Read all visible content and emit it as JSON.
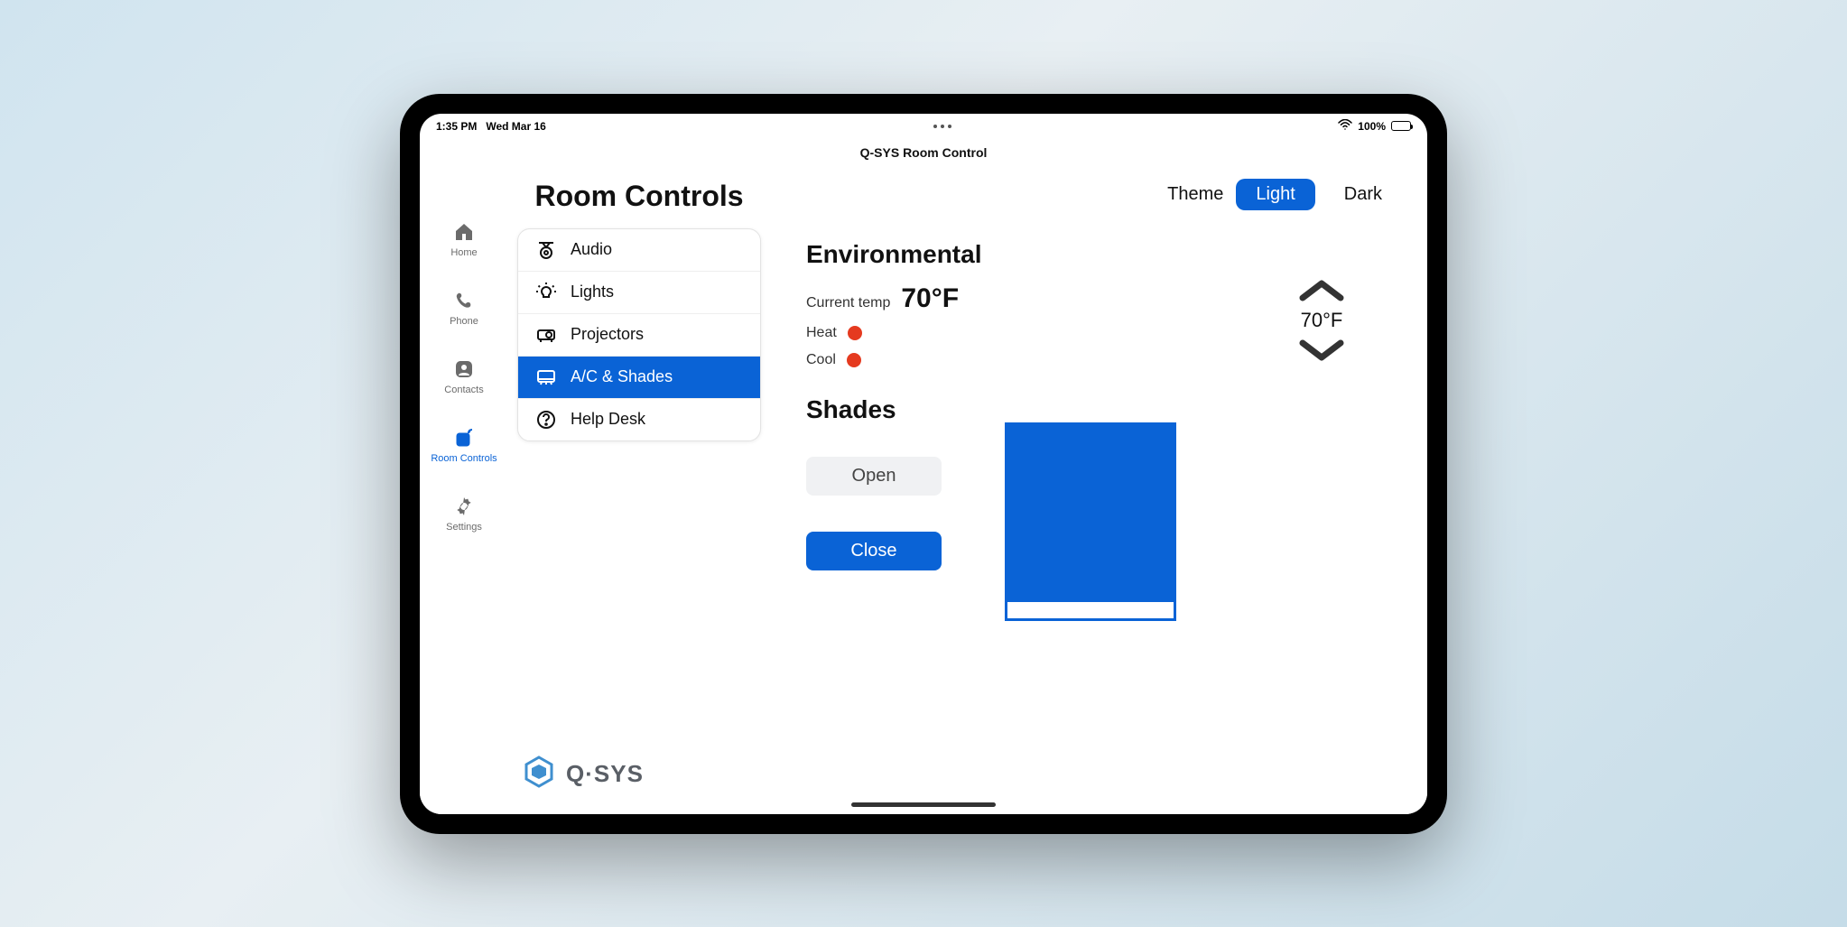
{
  "status": {
    "time": "1:35 PM",
    "date": "Wed Mar 16",
    "battery": "100%"
  },
  "app_title": "Q-SYS Room Control",
  "sidenav": {
    "items": [
      {
        "label": "Home"
      },
      {
        "label": "Phone"
      },
      {
        "label": "Contacts"
      },
      {
        "label": "Room Controls"
      },
      {
        "label": "Settings"
      }
    ]
  },
  "panel": {
    "title": "Room Controls",
    "menu": [
      {
        "label": "Audio"
      },
      {
        "label": "Lights"
      },
      {
        "label": "Projectors"
      },
      {
        "label": "A/C & Shades"
      },
      {
        "label": "Help Desk"
      }
    ]
  },
  "theme": {
    "label": "Theme",
    "light": "Light",
    "dark": "Dark",
    "active": "Light"
  },
  "environmental": {
    "title": "Environmental",
    "current_label": "Current temp",
    "current_value": "70°F",
    "heat_label": "Heat",
    "cool_label": "Cool",
    "setpoint": "70°F"
  },
  "shades": {
    "title": "Shades",
    "open_label": "Open",
    "close_label": "Close"
  },
  "brand": {
    "name": "Q·SYS"
  },
  "colors": {
    "primary": "#0a63d6",
    "indicator": "#e53a1f"
  }
}
